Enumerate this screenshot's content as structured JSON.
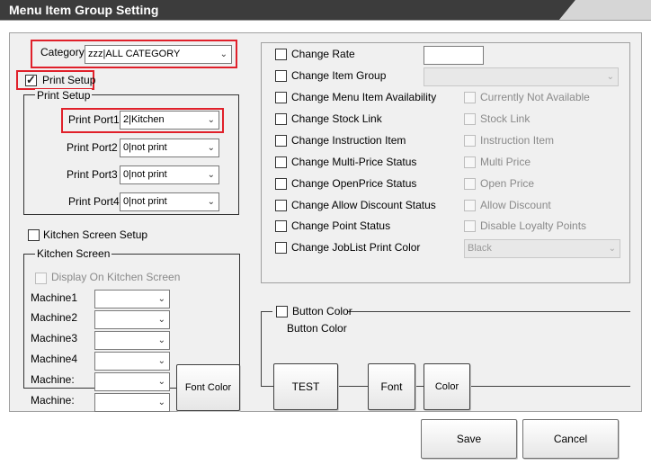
{
  "window": {
    "title": "Menu Item Group Setting"
  },
  "category": {
    "label": "Category",
    "value": "zzz|ALL CATEGORY"
  },
  "print_setup": {
    "checkbox_label": "Print Setup",
    "checked": true,
    "group_title": "Print Setup",
    "ports": [
      {
        "label": "Print Port1",
        "value": "2|Kitchen"
      },
      {
        "label": "Print Port2",
        "value": "0|not print"
      },
      {
        "label": "Print Port3",
        "value": "0|not print"
      },
      {
        "label": "Print Port4",
        "value": "0|not print"
      }
    ]
  },
  "kitchen": {
    "checkbox_label": "Kitchen Screen Setup",
    "group_title": "Kitchen Screen",
    "display_label": "Display On Kitchen Screen",
    "machines": [
      {
        "label": "Machine1",
        "value": ""
      },
      {
        "label": "Machine2",
        "value": ""
      },
      {
        "label": "Machine3",
        "value": ""
      },
      {
        "label": "Machine4",
        "value": ""
      },
      {
        "label": "Machine:",
        "value": ""
      },
      {
        "label": "Machine:",
        "value": ""
      }
    ],
    "font_color_label": "Font Color"
  },
  "changes": {
    "rate_label": "Change Rate",
    "rate_value": "",
    "item_group_label": "Change Item Group",
    "item_group_value": "",
    "rows": [
      {
        "label": "Change Menu Item Availability",
        "sub": "Currently Not Available"
      },
      {
        "label": "Change Stock Link",
        "sub": "Stock Link"
      },
      {
        "label": "Change Instruction Item",
        "sub": "Instruction Item"
      },
      {
        "label": "Change Multi-Price Status",
        "sub": "Multi Price"
      },
      {
        "label": "Change OpenPrice Status",
        "sub": "Open Price"
      },
      {
        "label": "Change Allow Discount Status",
        "sub": "Allow Discount"
      },
      {
        "label": "Change Point Status",
        "sub": "Disable Loyalty Points"
      }
    ],
    "joblist_label": "Change JobList Print Color",
    "joblist_value": "Black"
  },
  "button_color": {
    "checkbox_label": "Button Color",
    "subtitle": "Button Color",
    "test_label": "TEST",
    "font_label": "Font",
    "color_label": "Color"
  },
  "actions": {
    "save": "Save",
    "cancel": "Cancel"
  },
  "colors": {
    "title_bar": "#3c3c3c",
    "highlight": "#e0202a",
    "panel": "#f0f0f0"
  }
}
